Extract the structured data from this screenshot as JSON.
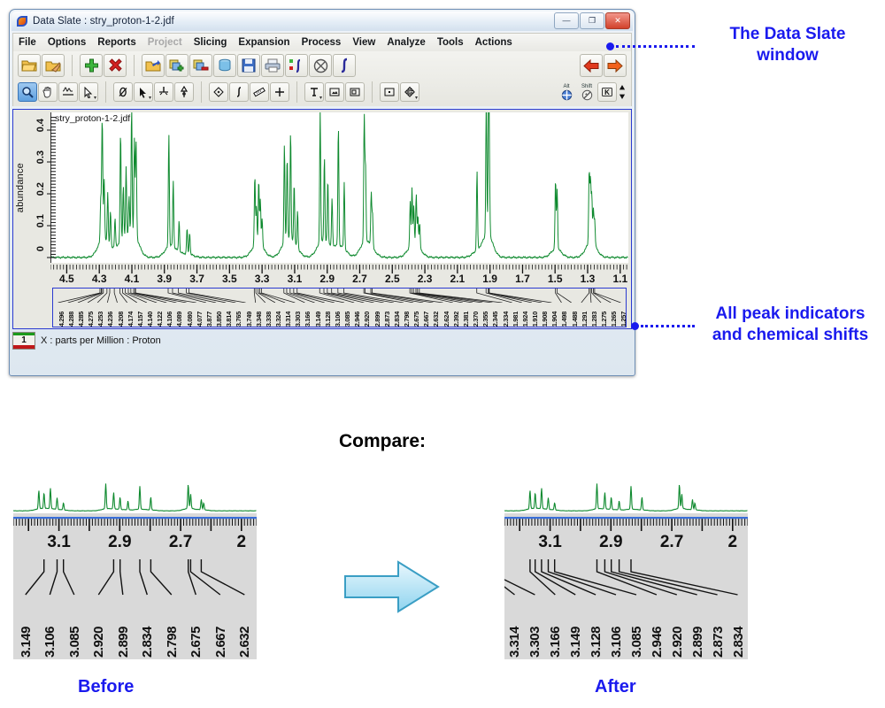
{
  "window": {
    "title": "Data Slate : stry_proton-1-2.jdf",
    "icon": "data-slate-logo-icon",
    "buttons": {
      "minimize": "—",
      "maximize": "❐",
      "close": "✕"
    }
  },
  "menu": {
    "items": [
      {
        "label": "File",
        "disabled": false
      },
      {
        "label": "Options",
        "disabled": false
      },
      {
        "label": "Reports",
        "disabled": false
      },
      {
        "label": "Project",
        "disabled": true
      },
      {
        "label": "Slicing",
        "disabled": false
      },
      {
        "label": "Expansion",
        "disabled": false
      },
      {
        "label": "Process",
        "disabled": false
      },
      {
        "label": "View",
        "disabled": false
      },
      {
        "label": "Analyze",
        "disabled": false
      },
      {
        "label": "Tools",
        "disabled": false
      },
      {
        "label": "Actions",
        "disabled": false
      }
    ]
  },
  "toolbar": {
    "row1": [
      "open-folder-icon",
      "open-recent-pointer-icon",
      "add-green-plus-icon",
      "delete-red-x-icon",
      "open-data-icon",
      "add-layer-icon",
      "remove-layer-icon",
      "trash-bin-icon",
      "save-floppy-icon",
      "print-icon",
      "integral-curve-icon",
      "cancel-circle-icon",
      "integral-icon",
      "back-arrow-icon",
      "forward-arrow-icon"
    ],
    "row2": [
      "zoom-magnifier-icon",
      "pan-hand-icon",
      "baseline-icon",
      "select-arrow-icon",
      "phase-null-icon",
      "cursor-pointer-icon",
      "peak-pick-icon",
      "peak-flag-icon",
      "diamond-icon",
      "integral-tool-icon",
      "ruler-icon",
      "crosshair-plus-icon",
      "text-tool-icon",
      "insert-image-icon",
      "frame-icon",
      "point-box-icon",
      "move-handles-icon",
      "alt-modifier-icon",
      "shift-modifier-icon",
      "keyboard-toggle-icon"
    ],
    "modifier_labels": {
      "alt": "Alt",
      "shift": "Shift"
    }
  },
  "plot": {
    "file_label": "stry_proton-1-2.jdf",
    "y_axis_title": "abundance",
    "status_text": "X : parts per Million : Proton",
    "page_number": "1",
    "trace_color": "#0f8a2f"
  },
  "chart_data": {
    "type": "line",
    "title": "stry_proton-1-2.jdf",
    "xlabel": "X : parts per Million : Proton",
    "ylabel": "abundance",
    "xlim": [
      4.6,
      1.05
    ],
    "ylim": [
      0,
      0.45
    ],
    "x_ticks": [
      "4.5",
      "4.3",
      "4.1",
      "3.9",
      "3.7",
      "3.5",
      "3.3",
      "3.1",
      "2.9",
      "2.7",
      "2.5",
      "2.3",
      "2.1",
      "1.9",
      "1.7",
      "1.5",
      "1.3",
      "1.1"
    ],
    "y_ticks": [
      "0",
      "0.1",
      "0.2",
      "0.3",
      "0.4"
    ],
    "grid": false,
    "legend": "none",
    "peaks": [
      {
        "shift": 4.296,
        "height": 0.13
      },
      {
        "shift": 4.288,
        "height": 0.26
      },
      {
        "shift": 4.285,
        "height": 0.17
      },
      {
        "shift": 4.275,
        "height": 0.19
      },
      {
        "shift": 4.253,
        "height": 0.16
      },
      {
        "shift": 4.236,
        "height": 0.11
      },
      {
        "shift": 4.208,
        "height": 0.09
      },
      {
        "shift": 4.174,
        "height": 0.35
      },
      {
        "shift": 4.157,
        "height": 0.17
      },
      {
        "shift": 4.14,
        "height": 0.22
      },
      {
        "shift": 4.122,
        "height": 0.12
      },
      {
        "shift": 4.106,
        "height": 0.4
      },
      {
        "shift": 4.089,
        "height": 0.3
      },
      {
        "shift": 4.08,
        "height": 0.2
      },
      {
        "shift": 4.077,
        "height": 0.14
      },
      {
        "shift": 3.877,
        "height": 0.36
      },
      {
        "shift": 3.85,
        "height": 0.21
      },
      {
        "shift": 3.814,
        "height": 0.1
      },
      {
        "shift": 3.765,
        "height": 0.08
      },
      {
        "shift": 3.749,
        "height": 0.07
      },
      {
        "shift": 3.348,
        "height": 0.22
      },
      {
        "shift": 3.338,
        "height": 0.12
      },
      {
        "shift": 3.324,
        "height": 0.2
      },
      {
        "shift": 3.314,
        "height": 0.14
      },
      {
        "shift": 3.303,
        "height": 0.09
      },
      {
        "shift": 3.166,
        "height": 0.31
      },
      {
        "shift": 3.149,
        "height": 0.26
      },
      {
        "shift": 3.128,
        "height": 0.34
      },
      {
        "shift": 3.106,
        "height": 0.19
      },
      {
        "shift": 3.085,
        "height": 0.12
      },
      {
        "shift": 2.946,
        "height": 0.42
      },
      {
        "shift": 2.92,
        "height": 0.27
      },
      {
        "shift": 2.899,
        "height": 0.2
      },
      {
        "shift": 2.873,
        "height": 0.15
      },
      {
        "shift": 2.834,
        "height": 0.38
      },
      {
        "shift": 2.798,
        "height": 0.21
      },
      {
        "shift": 2.675,
        "height": 0.4
      },
      {
        "shift": 2.667,
        "height": 0.24
      },
      {
        "shift": 2.632,
        "height": 0.17
      },
      {
        "shift": 2.624,
        "height": 0.11
      },
      {
        "shift": 2.392,
        "height": 0.14
      },
      {
        "shift": 2.381,
        "height": 0.18
      },
      {
        "shift": 2.37,
        "height": 0.12
      },
      {
        "shift": 2.355,
        "height": 0.16
      },
      {
        "shift": 2.345,
        "height": 0.1
      },
      {
        "shift": 2.334,
        "height": 0.08
      },
      {
        "shift": 1.981,
        "height": 0.25
      },
      {
        "shift": 1.924,
        "height": 0.44
      },
      {
        "shift": 1.91,
        "height": 0.3
      },
      {
        "shift": 1.908,
        "height": 0.21
      },
      {
        "shift": 1.904,
        "height": 0.12
      },
      {
        "shift": 1.498,
        "height": 0.22
      },
      {
        "shift": 1.488,
        "height": 0.19
      },
      {
        "shift": 1.291,
        "height": 0.23
      },
      {
        "shift": 1.283,
        "height": 0.2
      },
      {
        "shift": 1.275,
        "height": 0.15
      },
      {
        "shift": 1.265,
        "height": 0.11
      },
      {
        "shift": 1.257,
        "height": 0.08
      }
    ],
    "shift_labels": [
      "4.296",
      "4.288",
      "4.285",
      "4.275",
      "4.253",
      "4.236",
      "4.208",
      "4.174",
      "4.157",
      "4.140",
      "4.122",
      "4.106",
      "4.089",
      "4.080",
      "4.077",
      "3.877",
      "3.850",
      "3.814",
      "3.765",
      "3.749",
      "3.348",
      "3.338",
      "3.324",
      "3.314",
      "3.303",
      "3.166",
      "3.149",
      "3.128",
      "3.106",
      "3.085",
      "2.946",
      "2.920",
      "2.899",
      "2.873",
      "2.834",
      "2.798",
      "2.675",
      "2.667",
      "2.632",
      "2.624",
      "2.392",
      "2.381",
      "2.370",
      "2.355",
      "2.345",
      "2.334",
      "1.981",
      "1.924",
      "1.910",
      "1.908",
      "1.904",
      "1.498",
      "1.488",
      "1.291",
      "1.283",
      "1.275",
      "1.265",
      "1.257"
    ]
  },
  "annotations": {
    "window_callout": "The Data Slate\nwindow",
    "window_callout_line1": "The Data Slate",
    "window_callout_line2": "window",
    "peaks_callout_line1": "All peak indicators",
    "peaks_callout_line2": "and chemical shifts"
  },
  "compare": {
    "heading": "Compare:",
    "arrow": "right-arrow-icon",
    "before": {
      "caption": "Before",
      "ruler_labels": [
        "3.1",
        "2.9",
        "2.7",
        "2"
      ],
      "shift_labels": [
        "3.149",
        "3.106",
        "3.085",
        "2.920",
        "2.899",
        "2.834",
        "2.798",
        "2.675",
        "2.667",
        "2.632"
      ]
    },
    "after": {
      "caption": "After",
      "ruler_labels": [
        "3.1",
        "2.9",
        "2.7",
        "2"
      ],
      "shift_labels": [
        "3.314",
        "3.303",
        "3.166",
        "3.149",
        "3.128",
        "3.106",
        "3.085",
        "2.946",
        "2.920",
        "2.899",
        "2.873",
        "2.834"
      ]
    }
  },
  "colors": {
    "accent_blue": "#1a1aee",
    "trace_green": "#0f8a2f",
    "panel_gray": "#d9d9d9",
    "window_border": "#2b3ad0"
  }
}
